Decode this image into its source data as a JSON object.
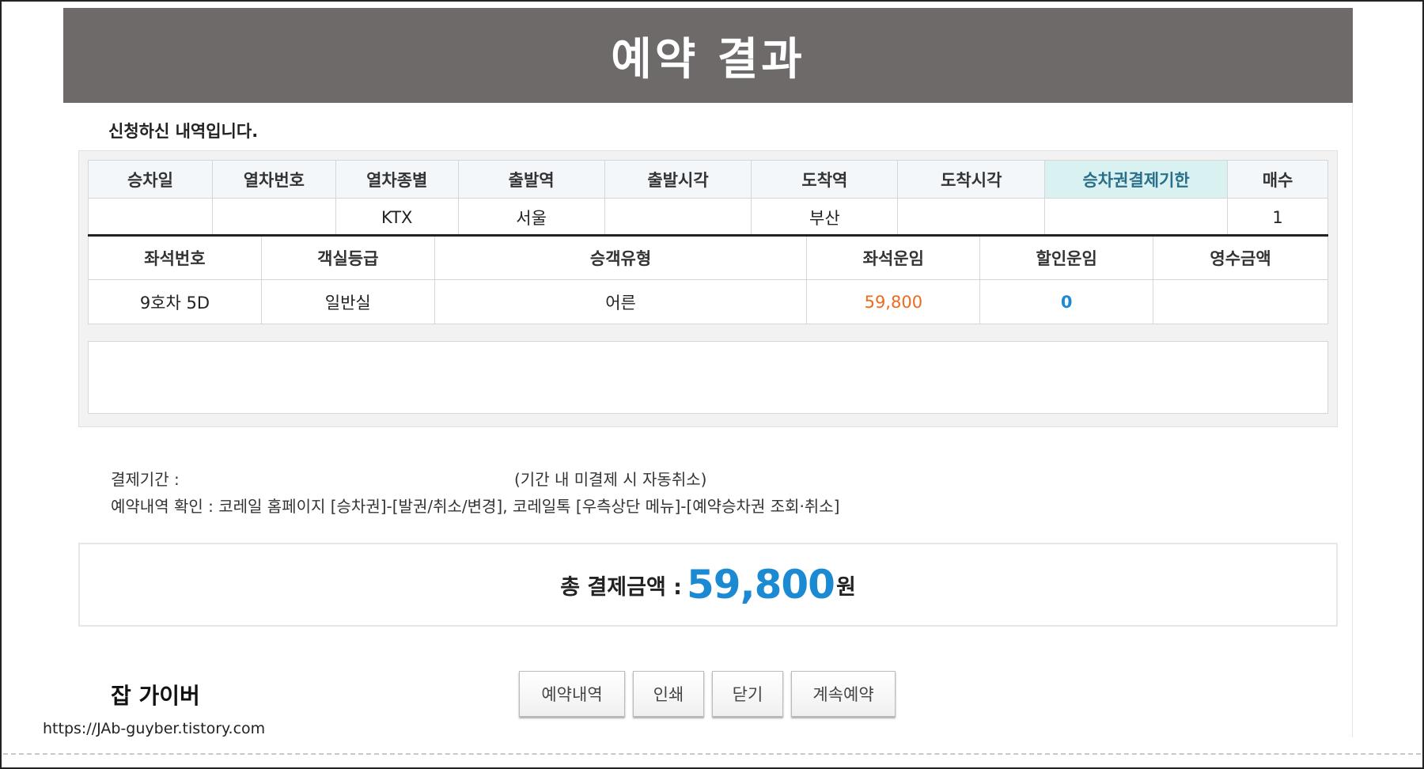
{
  "header": {
    "title": "예약 결과"
  },
  "intro": "신청하신 내역입니다.",
  "train_table": {
    "headers": [
      "승차일",
      "열차번호",
      "열차종별",
      "출발역",
      "출발시각",
      "도착역",
      "도착시각",
      "승차권결제기한",
      "매수"
    ],
    "row": [
      "",
      "",
      "KTX",
      "서울",
      "",
      "부산",
      "",
      "",
      "1"
    ]
  },
  "seat_table": {
    "headers": [
      "좌석번호",
      "객실등급",
      "승객유형",
      "좌석운임",
      "할인운임",
      "영수금액"
    ],
    "row": [
      "9호차 5D",
      "일반실",
      "어른",
      "59,800",
      "0",
      ""
    ]
  },
  "info": {
    "payment_period_label": "결제기간 :",
    "payment_period_note": "(기간 내 미결제 시 자동취소)",
    "confirm_text": "예약내역 확인 : 코레일 홈페이지 [승차권]-[발권/취소/변경], 코레일톡 [우측상단 메뉴]-[예약승차권 조회·취소]"
  },
  "total": {
    "label": "총 결제금액 :",
    "amount": "59,800",
    "unit": "원"
  },
  "buttons": {
    "history": "예약내역",
    "print": "인쇄",
    "close": "닫기",
    "continue": "계속예약"
  },
  "watermark": {
    "name": "잡 가이버",
    "url": "https://JAb-guyber.tistory.com"
  },
  "colors": {
    "header_bg": "#6e6a6a",
    "accent_blue": "#1b8ad3",
    "fare_orange": "#ee6a1f",
    "deadline_bg": "#d9f1f1"
  }
}
